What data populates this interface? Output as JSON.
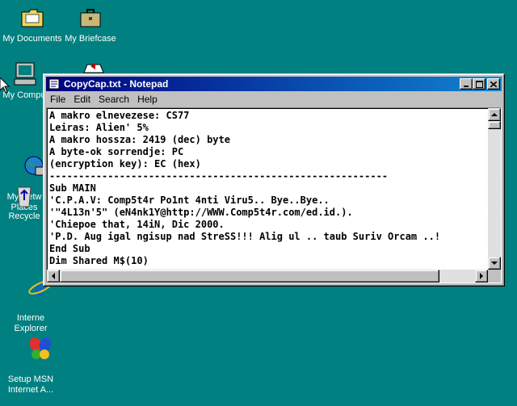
{
  "desktop": {
    "icons": [
      {
        "label": "My Documents"
      },
      {
        "label": "My Briefcase"
      },
      {
        "label": "My Compu"
      },
      {
        "label": "My Netw\nPlaces"
      },
      {
        "label": "Recycle"
      },
      {
        "label": "Interne\nExplorer"
      },
      {
        "label": "Setup MSN\nInternet A..."
      }
    ]
  },
  "window": {
    "title": "CopyCap.txt - Notepad",
    "menu": {
      "file": "File",
      "edit": "Edit",
      "search": "Search",
      "help": "Help"
    },
    "buttons": {
      "minimize": "_",
      "maximize": "□",
      "close": "×"
    },
    "content": "A makro elnevezese: CS77\nLeiras: Alien' 5%\nA makro hossza: 2419 (dec) byte\nA byte-ok sorrendje: PC\n(encryption key): EC (hex)\n----------------------------------------------------------\nSub MAIN\n'C.P.A.V: Comp5t4r Po1nt 4nti Viru5.. Bye..Bye..\n'\"4L13n'5\" (eN4nk1Y@http://WWW.Comp5t4r.com/ed.id.).\n'Chiepoe that, 14iN, Dic 2000.\n'P.D. Aug igal ngisup nad StreSS!!! Alig ul .. taub Suriv Orcam ..!\nEnd Sub\nDim Shared M$(10)"
  },
  "colors": {
    "desktop": "#008080",
    "titlebar_start": "#000080",
    "titlebar_end": "#1084d0"
  }
}
